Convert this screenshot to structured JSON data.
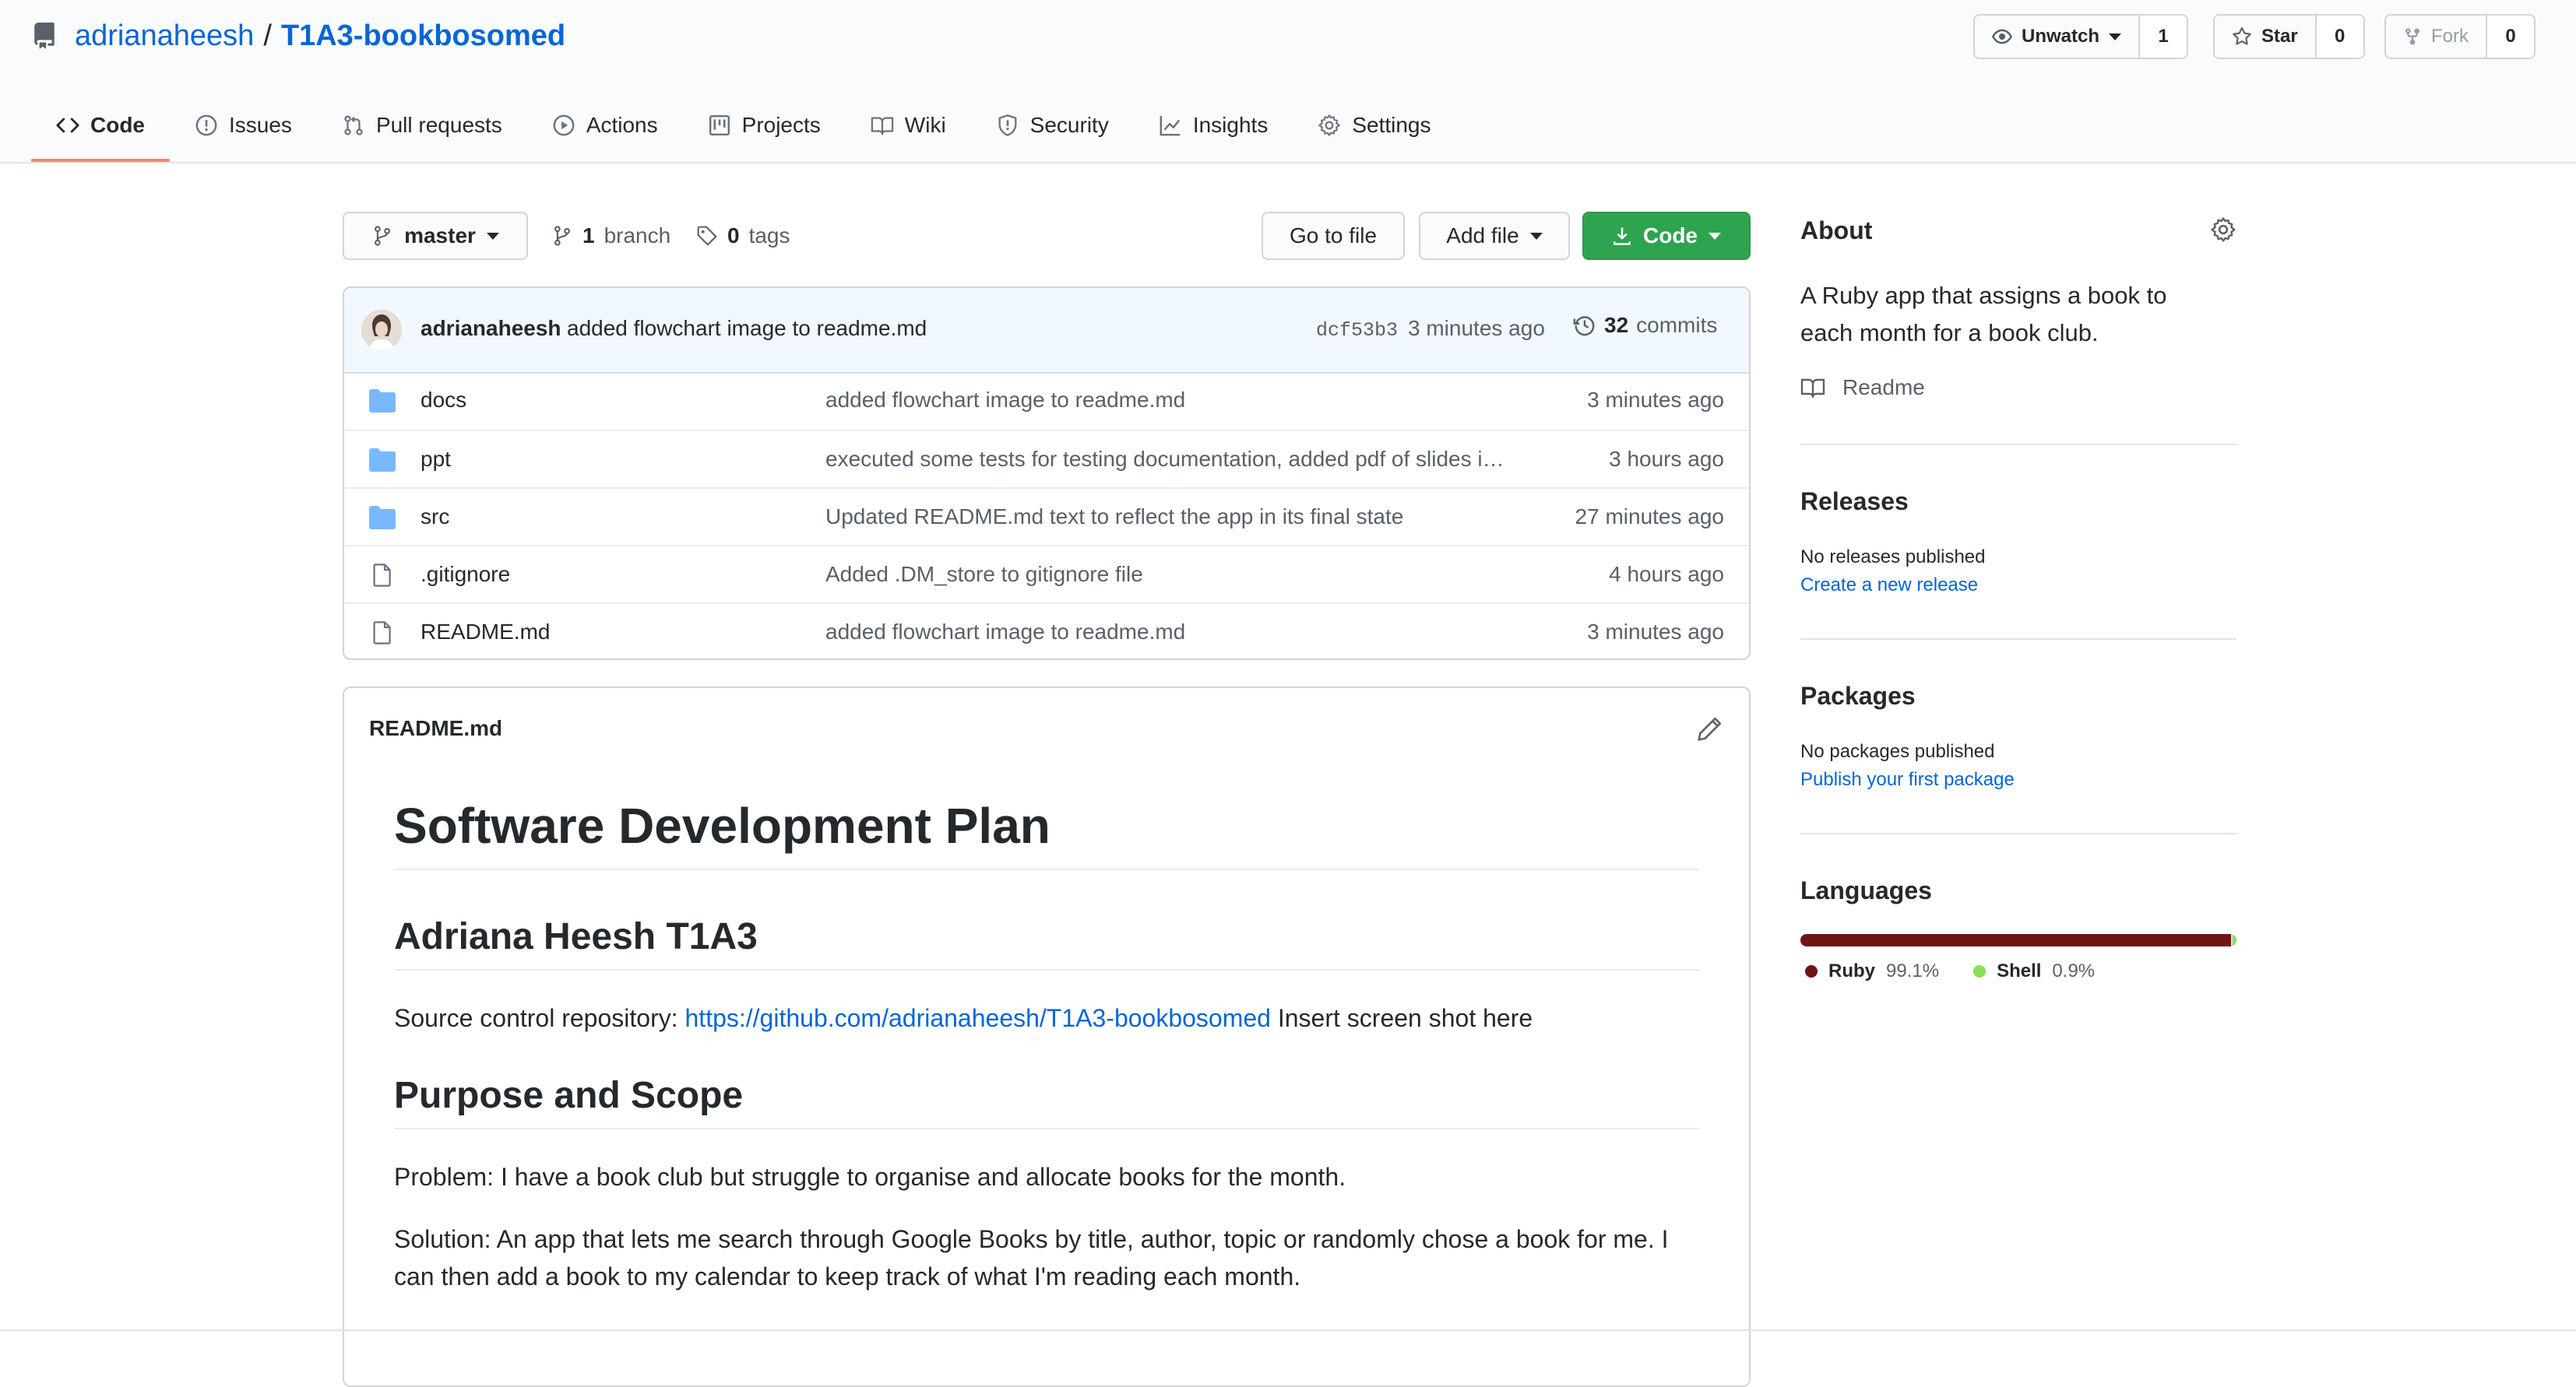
{
  "header": {
    "owner": "adrianaheesh",
    "separator": "/",
    "repo": "T1A3-bookbosomed",
    "watch": {
      "label": "Unwatch",
      "count": "1"
    },
    "star": {
      "label": "Star",
      "count": "0"
    },
    "fork": {
      "label": "Fork",
      "count": "0"
    }
  },
  "tabs": [
    {
      "label": "Code",
      "icon": "code-icon",
      "active": true
    },
    {
      "label": "Issues",
      "icon": "issue-icon"
    },
    {
      "label": "Pull requests",
      "icon": "pull-request-icon"
    },
    {
      "label": "Actions",
      "icon": "play-icon"
    },
    {
      "label": "Projects",
      "icon": "project-icon"
    },
    {
      "label": "Wiki",
      "icon": "book-icon"
    },
    {
      "label": "Security",
      "icon": "shield-icon"
    },
    {
      "label": "Insights",
      "icon": "graph-icon"
    },
    {
      "label": "Settings",
      "icon": "gear-icon"
    }
  ],
  "toolbar": {
    "branch": "master",
    "branch_count": "1",
    "branch_word": "branch",
    "tag_count": "0",
    "tag_word": "tags",
    "go_to_file": "Go to file",
    "add_file": "Add file",
    "code": "Code"
  },
  "commit": {
    "author": "adrianaheesh",
    "message": "added flowchart image to readme.md",
    "sha": "dcf53b3",
    "time": "3 minutes ago",
    "count": "32",
    "count_word": "commits"
  },
  "files": [
    {
      "type": "folder",
      "name": "docs",
      "message": "added flowchart image to readme.md",
      "age": "3 minutes ago"
    },
    {
      "type": "folder",
      "name": "ppt",
      "message": "executed some tests for testing documentation, added pdf of slides i…",
      "age": "3 hours ago"
    },
    {
      "type": "folder",
      "name": "src",
      "message": "Updated README.md text to reflect the app in its final state",
      "age": "27 minutes ago"
    },
    {
      "type": "file",
      "name": ".gitignore",
      "message": "Added .DM_store to gitignore file",
      "age": "4 hours ago"
    },
    {
      "type": "file",
      "name": "README.md",
      "message": "added flowchart image to readme.md",
      "age": "3 minutes ago"
    }
  ],
  "readme": {
    "filename": "README.md",
    "h1": "Software Development Plan",
    "h2_author": "Adriana Heesh T1A3",
    "source_label": "Source control repository:",
    "source_url": "https://github.com/adrianaheesh/T1A3-bookbosomed",
    "source_tail": "Insert screen shot here",
    "h2_purpose": "Purpose and Scope",
    "problem": "Problem: I have a book club but struggle to organise and allocate books for the month.",
    "solution_line1": "Solution: An app that lets me search through Google Books by title, author, topic or randomly chose a book for me. I",
    "solution_line2": "can then add a book to my calendar to keep track of what I'm reading each month."
  },
  "sidebar": {
    "about_title": "About",
    "about_line1": "A Ruby app that assigns a book to",
    "about_line2": "each month for a book club.",
    "readme_link": "Readme",
    "releases_title": "Releases",
    "releases_none": "No releases published",
    "releases_link": "Create a new release",
    "packages_title": "Packages",
    "packages_none": "No packages published",
    "packages_link": "Publish your first package",
    "languages_title": "Languages",
    "languages": [
      {
        "name": "Ruby",
        "percent": "99.1%",
        "share": 99.1,
        "color": "#701516"
      },
      {
        "name": "Shell",
        "percent": "0.9%",
        "share": 0.9,
        "color": "#89e051"
      }
    ]
  },
  "colors": {
    "link": "#0366d6",
    "tab_underline": "#f9826c",
    "code_button": "#2ea44f",
    "folder": "#79b8ff"
  }
}
